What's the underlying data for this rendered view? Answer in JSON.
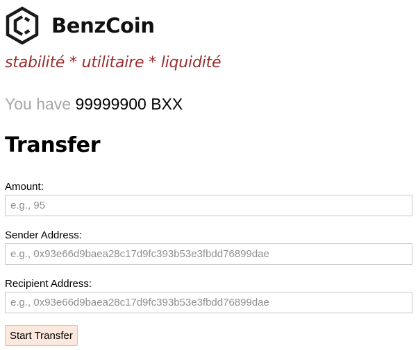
{
  "app": {
    "logo_icon": "hexagon-logo-icon",
    "name": "BenzCoin",
    "tagline": "stabilité * utilitaire * liquidité"
  },
  "balance": {
    "prefix": "You have",
    "amount": "99999900 BXX"
  },
  "transfer": {
    "title": "Transfer",
    "amount_label": "Amount:",
    "amount_placeholder": "e.g., 95",
    "amount_value": "",
    "sender_label": "Sender Address:",
    "sender_placeholder": "e.g., 0x93e66d9baea28c17d9fc393b53e3fbdd76899dae",
    "sender_value": "",
    "recipient_label": "Recipient Address:",
    "recipient_placeholder": "e.g., 0x93e66d9baea28c17d9fc393b53e3fbdd76899dae",
    "recipient_value": "",
    "submit_label": "Start Transfer"
  },
  "colors": {
    "tagline": "#9b2c2c",
    "muted": "#a7a7a7",
    "button_bg": "#fde8de"
  }
}
